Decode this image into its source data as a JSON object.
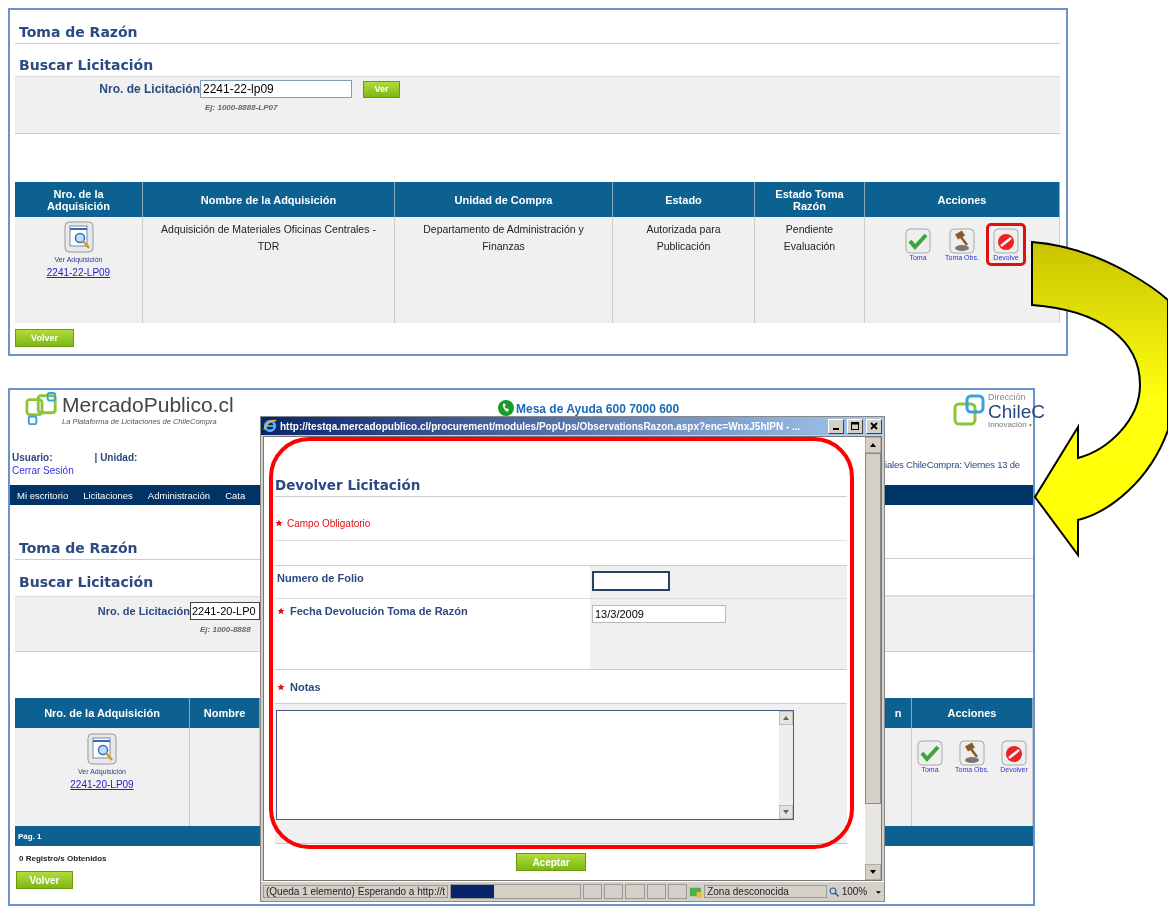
{
  "top_screen": {
    "page_title": "Toma de Razón",
    "section_title": "Buscar Licitación",
    "search": {
      "label": "Nro. de Licitación",
      "value": "2241-22-lp09",
      "hint": "Ej: 1000-8888-LP07",
      "button": "Ver"
    },
    "table": {
      "columns": [
        "Nro. de la Adquisición",
        "Nombre de la Adquisición",
        "Unidad de Compra",
        "Estado",
        "Estado Toma Razón",
        "Acciones"
      ],
      "rows": [
        {
          "view_label": "Ver Adquisición",
          "number": "2241-22-LP09",
          "name": "Adquisición de Materiales Oficinas Centrales - TDR",
          "unit": "Departamento de Administración y Finanzas",
          "status": "Autorizada para Publicación",
          "review_status": "Pendiente Evaluación",
          "actions": [
            {
              "kind": "approve",
              "label": "Toma",
              "highlighted": false
            },
            {
              "kind": "observe",
              "label": "Toma Obs.",
              "highlighted": false
            },
            {
              "kind": "return",
              "label": "Devolve",
              "highlighted": true
            }
          ]
        }
      ]
    },
    "back_button": "Volver"
  },
  "bottom_screen": {
    "logo": {
      "name": "MercadoPublico.cl",
      "tagline": "La Plataforma de Licitaciones de ChileCompra"
    },
    "helpdesk": "Mesa de Ayuda 600 7000 600",
    "partner_logo": {
      "line_1": "Dirección",
      "line_2": "ChileC",
      "line_3": "Innovación •"
    },
    "user_label": "Usuario:",
    "unit_label": "| Unidad:",
    "logout_link": "Cerrar Sesión",
    "date_text": "iales ChileCompra: Viernes 13 de",
    "nav": [
      "Mi escritorio",
      "Licitaciones",
      "Administración",
      "Cata"
    ],
    "page_title": "Toma de Razón",
    "section_title": "Buscar Licitación",
    "search": {
      "label": "Nro. de Licitación",
      "value": "2241-20-LP0",
      "hint": "Ej: 1000-8888"
    },
    "table": {
      "columns": [
        "Nro. de la Adquisición",
        "Nombre"
      ],
      "right_columns": [
        "n",
        "Acciones"
      ],
      "rows": [
        {
          "view_label": "Ver Adquisición",
          "number": "2241-20-LP09",
          "actions": [
            {
              "kind": "approve",
              "label": "Toma",
              "highlighted": false
            },
            {
              "kind": "observe",
              "label": "Toma Obs.",
              "highlighted": false
            },
            {
              "kind": "return",
              "label": "Devolver",
              "highlighted": false
            }
          ]
        }
      ]
    },
    "pager": "Pág. 1",
    "records": "0 Registro/s Obtenidos",
    "back_button": "Volver",
    "popup": {
      "title": "http://testqa.mercadopublico.cl/procurement/modules/PopUps/ObservationsRazon.aspx?enc=WnxJ5hIPN - ...",
      "highlighted": true,
      "heading": "Devolver Licitación",
      "required_note": "Campo Obligatorio",
      "fields": [
        {
          "kind": "text",
          "label": "Numero de Folio",
          "required": false
        },
        {
          "kind": "date",
          "label": "Fecha Devolución Toma de Razón",
          "required": true,
          "value": "13/3/2009"
        },
        {
          "kind": "textarea",
          "label": "Notas",
          "required": true
        }
      ],
      "submit_button": "Aceptar",
      "status_bar": {
        "message": "(Queda 1 elemento) Esperando a http://t",
        "progress": {
          "level": 0.33
        },
        "zone": "Zona desconocida",
        "zoom": "100%"
      }
    }
  }
}
